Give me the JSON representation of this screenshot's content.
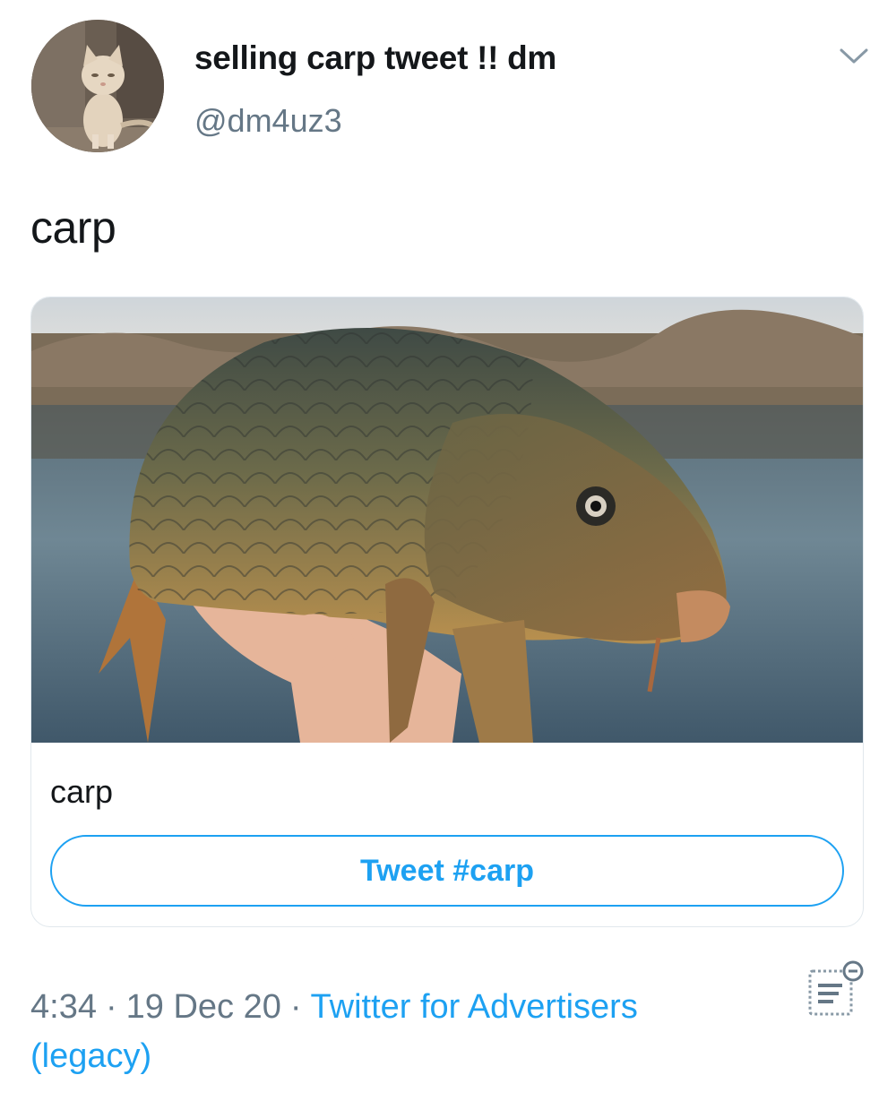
{
  "tweet": {
    "display_name": "selling carp tweet !! dm",
    "handle": "@dm4uz3",
    "text": "carp",
    "avatar_icon": "cat-avatar",
    "menu_icon": "chevron-down-icon"
  },
  "card": {
    "image_subject": "carp fish held in hand",
    "title": "carp",
    "button_label": "Tweet #carp",
    "accent": "#1da1f2"
  },
  "meta": {
    "time": "4:34",
    "date": "19 Dec 20",
    "separator": "·",
    "source": "Twitter for Advertisers (legacy)",
    "analytics_icon": "analytics-icon"
  },
  "colors": {
    "text": "#14171a",
    "secondary": "#657786",
    "border": "#e1e8ed",
    "link": "#1da1f2"
  }
}
